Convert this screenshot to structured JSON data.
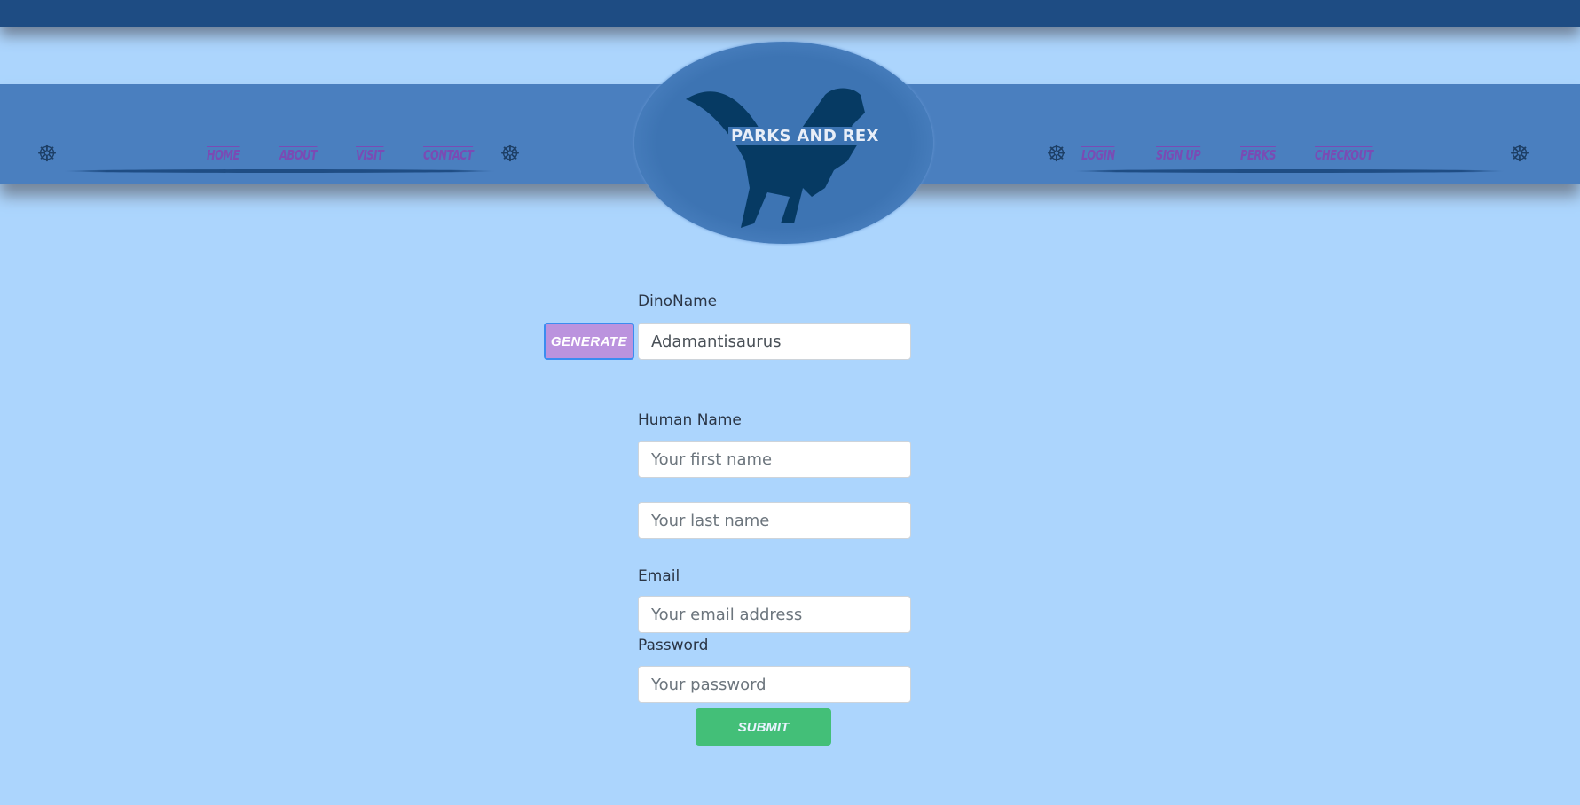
{
  "brand": {
    "logo_text": "PARKS AND REX"
  },
  "nav_left": [
    {
      "label": "HOME"
    },
    {
      "label": "ABOUT"
    },
    {
      "label": "VISIT"
    },
    {
      "label": "CONTACT"
    }
  ],
  "nav_right": [
    {
      "label": "LOGIN"
    },
    {
      "label": "SIGN UP"
    },
    {
      "label": "PERKS"
    },
    {
      "label": "CHECKOUT"
    }
  ],
  "icons": {
    "nav_decoration": "dino-skeleton-icon",
    "logo": "t-rex-silhouette"
  },
  "form": {
    "dino_label": "DinoName",
    "generate_label": "GENERATE",
    "dino_value": "Adamantisaurus",
    "human_label": "Human Name",
    "first_placeholder": "Your first name",
    "last_placeholder": "Your last name",
    "email_label": "Email",
    "email_placeholder": "Your email address",
    "password_label": "Password",
    "password_placeholder": "Your password",
    "submit_label": "SUBMIT"
  },
  "colors": {
    "background": "#acd5fd",
    "nav": "#4a7fbf",
    "link": "#7a4bb4",
    "generate": "#bb93de",
    "submit": "#43bf78"
  }
}
